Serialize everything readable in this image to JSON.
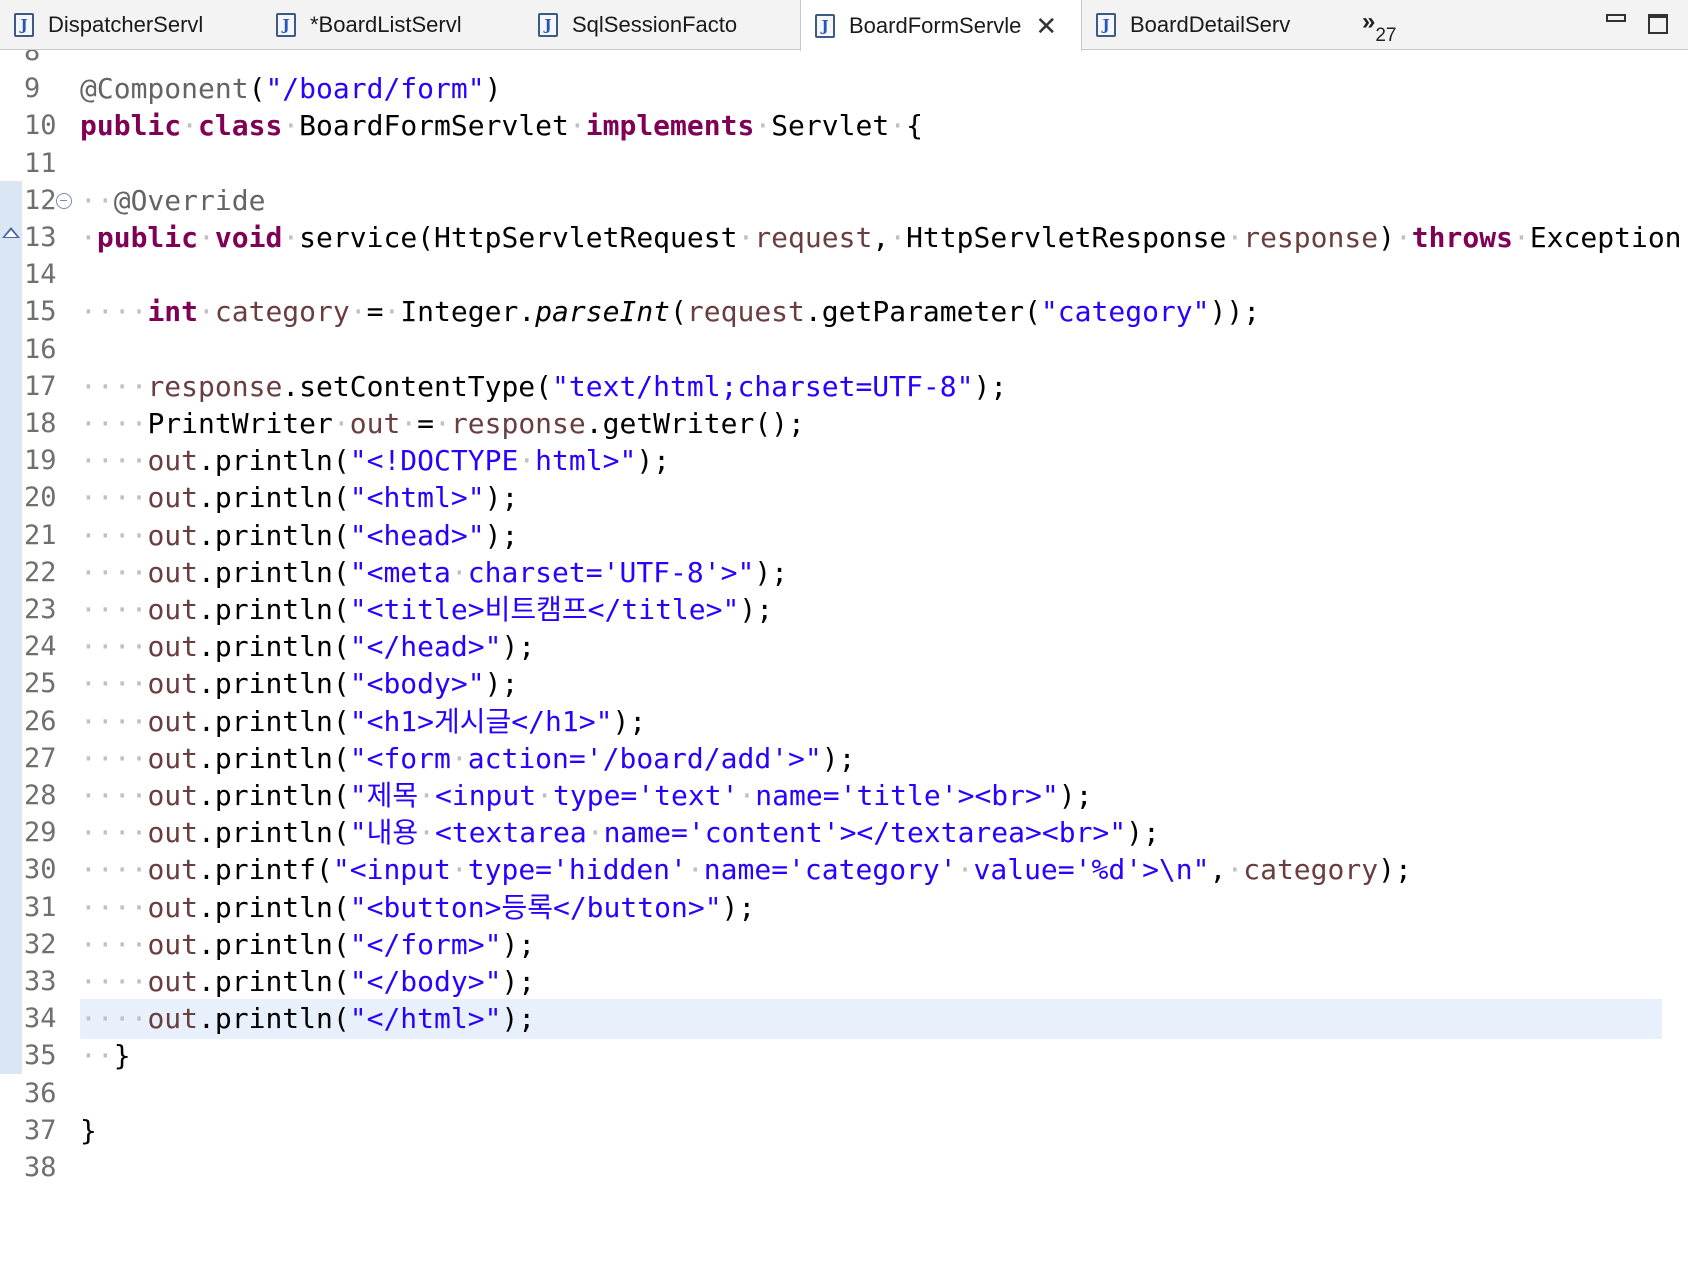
{
  "tabs": [
    {
      "label": "DispatcherServl",
      "active": false,
      "icon": "java-file-icon"
    },
    {
      "label": "*BoardListServl",
      "active": false,
      "icon": "java-file-icon"
    },
    {
      "label": "SqlSessionFacto",
      "active": false,
      "icon": "java-file-icon"
    },
    {
      "label": "BoardFormServle",
      "active": true,
      "icon": "java-file-icon",
      "closable": true
    },
    {
      "label": "BoardDetailServ",
      "active": false,
      "icon": "java-file-icon"
    }
  ],
  "overflow": {
    "chevron": "»",
    "count": "27"
  },
  "window_controls": {
    "minimize": "minimize-icon",
    "maximize": "maximize-icon"
  },
  "editor": {
    "current_line": 34,
    "lines": [
      {
        "n": "8",
        "tokens": []
      },
      {
        "n": "9",
        "tokens": [
          [
            "ann",
            "@Component"
          ],
          [
            "plain",
            "("
          ],
          [
            "str",
            "\"/board/form\""
          ],
          [
            "plain",
            ")"
          ]
        ]
      },
      {
        "n": "10",
        "tokens": [
          [
            "kw",
            "public"
          ],
          [
            "ws",
            "·"
          ],
          [
            "kw",
            "class"
          ],
          [
            "ws",
            "·"
          ],
          [
            "plain",
            "BoardFormServlet"
          ],
          [
            "ws",
            "·"
          ],
          [
            "kw",
            "implements"
          ],
          [
            "ws",
            "·"
          ],
          [
            "plain",
            "Servlet"
          ],
          [
            "ws",
            "·"
          ],
          [
            "plain",
            "{"
          ]
        ]
      },
      {
        "n": "11",
        "tokens": []
      },
      {
        "n": "12",
        "fold": true,
        "tokens": [
          [
            "ws",
            "··"
          ],
          [
            "ann",
            "@Override"
          ]
        ]
      },
      {
        "n": "13",
        "override": true,
        "tokens": [
          [
            "ws",
            "·"
          ],
          [
            "kw",
            "public"
          ],
          [
            "ws",
            "·"
          ],
          [
            "kw",
            "void"
          ],
          [
            "ws",
            "·"
          ],
          [
            "plain",
            "service(HttpServletRequest"
          ],
          [
            "ws",
            "·"
          ],
          [
            "var",
            "request"
          ],
          [
            "plain",
            ","
          ],
          [
            "ws",
            "·"
          ],
          [
            "plain",
            "HttpServletResponse"
          ],
          [
            "ws",
            "·"
          ],
          [
            "var",
            "response"
          ],
          [
            "plain",
            ")"
          ],
          [
            "ws",
            "·"
          ],
          [
            "kw",
            "throws"
          ],
          [
            "ws",
            "·"
          ],
          [
            "plain",
            "Exception"
          ],
          [
            "ws",
            "·"
          ],
          [
            "plain",
            "{"
          ]
        ]
      },
      {
        "n": "14",
        "tokens": []
      },
      {
        "n": "15",
        "tokens": [
          [
            "ws",
            "····"
          ],
          [
            "kw",
            "int"
          ],
          [
            "ws",
            "·"
          ],
          [
            "var",
            "category"
          ],
          [
            "ws",
            "·"
          ],
          [
            "plain",
            "="
          ],
          [
            "ws",
            "·"
          ],
          [
            "plain",
            "Integer."
          ],
          [
            "ital",
            "parseInt"
          ],
          [
            "plain",
            "("
          ],
          [
            "var",
            "request"
          ],
          [
            "plain",
            ".getParameter("
          ],
          [
            "str",
            "\"category\""
          ],
          [
            "plain",
            "));"
          ]
        ]
      },
      {
        "n": "16",
        "tokens": []
      },
      {
        "n": "17",
        "tokens": [
          [
            "ws",
            "····"
          ],
          [
            "var",
            "response"
          ],
          [
            "plain",
            ".setContentType("
          ],
          [
            "str",
            "\"text/html;charset=UTF-8\""
          ],
          [
            "plain",
            ");"
          ]
        ]
      },
      {
        "n": "18",
        "tokens": [
          [
            "ws",
            "····"
          ],
          [
            "plain",
            "PrintWriter"
          ],
          [
            "ws",
            "·"
          ],
          [
            "var",
            "out"
          ],
          [
            "ws",
            "·"
          ],
          [
            "plain",
            "="
          ],
          [
            "ws",
            "·"
          ],
          [
            "var",
            "response"
          ],
          [
            "plain",
            ".getWriter();"
          ]
        ]
      },
      {
        "n": "19",
        "tokens": [
          [
            "ws",
            "····"
          ],
          [
            "var",
            "out"
          ],
          [
            "plain",
            ".println("
          ],
          [
            "str",
            "\"<!DOCTYPE"
          ],
          [
            "ws",
            "·"
          ],
          [
            "str",
            "html>\""
          ],
          [
            "plain",
            ");"
          ]
        ]
      },
      {
        "n": "20",
        "tokens": [
          [
            "ws",
            "····"
          ],
          [
            "var",
            "out"
          ],
          [
            "plain",
            ".println("
          ],
          [
            "str",
            "\"<html>\""
          ],
          [
            "plain",
            ");"
          ]
        ]
      },
      {
        "n": "21",
        "tokens": [
          [
            "ws",
            "····"
          ],
          [
            "var",
            "out"
          ],
          [
            "plain",
            ".println("
          ],
          [
            "str",
            "\"<head>\""
          ],
          [
            "plain",
            ");"
          ]
        ]
      },
      {
        "n": "22",
        "tokens": [
          [
            "ws",
            "····"
          ],
          [
            "var",
            "out"
          ],
          [
            "plain",
            ".println("
          ],
          [
            "str",
            "\"<meta"
          ],
          [
            "ws",
            "·"
          ],
          [
            "str",
            "charset='UTF-8'>\""
          ],
          [
            "plain",
            ");"
          ]
        ]
      },
      {
        "n": "23",
        "tokens": [
          [
            "ws",
            "····"
          ],
          [
            "var",
            "out"
          ],
          [
            "plain",
            ".println("
          ],
          [
            "str",
            "\"<title>비트캠프</title>\""
          ],
          [
            "plain",
            ");"
          ]
        ]
      },
      {
        "n": "24",
        "tokens": [
          [
            "ws",
            "····"
          ],
          [
            "var",
            "out"
          ],
          [
            "plain",
            ".println("
          ],
          [
            "str",
            "\"</head>\""
          ],
          [
            "plain",
            ");"
          ]
        ]
      },
      {
        "n": "25",
        "tokens": [
          [
            "ws",
            "····"
          ],
          [
            "var",
            "out"
          ],
          [
            "plain",
            ".println("
          ],
          [
            "str",
            "\"<body>\""
          ],
          [
            "plain",
            ");"
          ]
        ]
      },
      {
        "n": "26",
        "tokens": [
          [
            "ws",
            "····"
          ],
          [
            "var",
            "out"
          ],
          [
            "plain",
            ".println("
          ],
          [
            "str",
            "\"<h1>게시글</h1>\""
          ],
          [
            "plain",
            ");"
          ]
        ]
      },
      {
        "n": "27",
        "tokens": [
          [
            "ws",
            "····"
          ],
          [
            "var",
            "out"
          ],
          [
            "plain",
            ".println("
          ],
          [
            "str",
            "\"<form"
          ],
          [
            "ws",
            "·"
          ],
          [
            "str",
            "action='/board/add'>\""
          ],
          [
            "plain",
            ");"
          ]
        ]
      },
      {
        "n": "28",
        "tokens": [
          [
            "ws",
            "····"
          ],
          [
            "var",
            "out"
          ],
          [
            "plain",
            ".println("
          ],
          [
            "str",
            "\"제목"
          ],
          [
            "ws",
            "·"
          ],
          [
            "str",
            "<input"
          ],
          [
            "ws",
            "·"
          ],
          [
            "str",
            "type='text'"
          ],
          [
            "ws",
            "·"
          ],
          [
            "str",
            "name='title'><br>\""
          ],
          [
            "plain",
            ");"
          ]
        ]
      },
      {
        "n": "29",
        "tokens": [
          [
            "ws",
            "····"
          ],
          [
            "var",
            "out"
          ],
          [
            "plain",
            ".println("
          ],
          [
            "str",
            "\"내용"
          ],
          [
            "ws",
            "·"
          ],
          [
            "str",
            "<textarea"
          ],
          [
            "ws",
            "·"
          ],
          [
            "str",
            "name='content'></textarea><br>\""
          ],
          [
            "plain",
            ");"
          ]
        ]
      },
      {
        "n": "30",
        "tokens": [
          [
            "ws",
            "····"
          ],
          [
            "var",
            "out"
          ],
          [
            "plain",
            ".printf("
          ],
          [
            "str",
            "\"<input"
          ],
          [
            "ws",
            "·"
          ],
          [
            "str",
            "type='hidden'"
          ],
          [
            "ws",
            "·"
          ],
          [
            "str",
            "name='category'"
          ],
          [
            "ws",
            "·"
          ],
          [
            "str",
            "value='%d'>\\n\""
          ],
          [
            "plain",
            ","
          ],
          [
            "ws",
            "·"
          ],
          [
            "var",
            "category"
          ],
          [
            "plain",
            ");"
          ]
        ]
      },
      {
        "n": "31",
        "tokens": [
          [
            "ws",
            "····"
          ],
          [
            "var",
            "out"
          ],
          [
            "plain",
            ".println("
          ],
          [
            "str",
            "\"<button>등록</button>\""
          ],
          [
            "plain",
            ");"
          ]
        ]
      },
      {
        "n": "32",
        "tokens": [
          [
            "ws",
            "····"
          ],
          [
            "var",
            "out"
          ],
          [
            "plain",
            ".println("
          ],
          [
            "str",
            "\"</form>\""
          ],
          [
            "plain",
            ");"
          ]
        ]
      },
      {
        "n": "33",
        "tokens": [
          [
            "ws",
            "····"
          ],
          [
            "var",
            "out"
          ],
          [
            "plain",
            ".println("
          ],
          [
            "str",
            "\"</body>\""
          ],
          [
            "plain",
            ");"
          ]
        ]
      },
      {
        "n": "34",
        "tokens": [
          [
            "ws",
            "····"
          ],
          [
            "var",
            "out"
          ],
          [
            "plain",
            ".println("
          ],
          [
            "str",
            "\"</html>\""
          ],
          [
            "plain",
            ");"
          ]
        ]
      },
      {
        "n": "35",
        "tokens": [
          [
            "ws",
            "··"
          ],
          [
            "plain",
            "}"
          ]
        ]
      },
      {
        "n": "36",
        "tokens": []
      },
      {
        "n": "37",
        "tokens": [
          [
            "plain",
            "}"
          ]
        ]
      },
      {
        "n": "38",
        "tokens": []
      }
    ]
  },
  "colors": {
    "keyword": "#7f0055",
    "string": "#2a00ff",
    "annotation": "#646464",
    "variable": "#6a3e3e",
    "current_line_bg": "#e8f0fc",
    "gutter_highlight": "#dbe6f5"
  }
}
